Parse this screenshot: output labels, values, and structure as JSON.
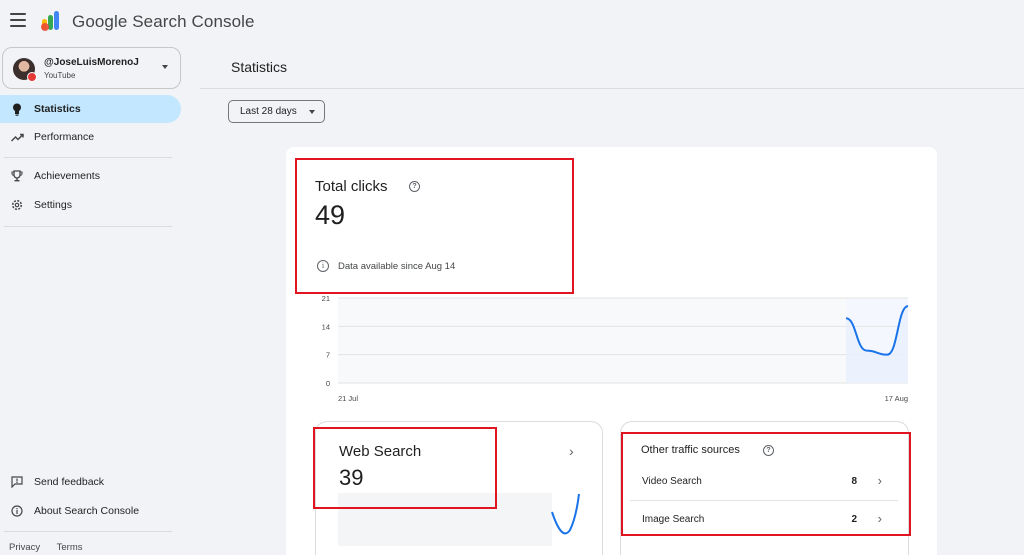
{
  "app": {
    "title": "Google Search Console"
  },
  "account": {
    "name": "@JoseLuisMorenoJ",
    "subtitle": "YouTube"
  },
  "sidebar": {
    "items": [
      {
        "label": "Statistics",
        "icon": "lightbulb-icon",
        "active": true
      },
      {
        "label": "Performance",
        "icon": "trending-up-icon"
      },
      {
        "label": "Achievements",
        "icon": "trophy-icon"
      },
      {
        "label": "Settings",
        "icon": "gear-icon"
      }
    ],
    "bottom": [
      {
        "label": "Send feedback",
        "icon": "feedback-icon"
      },
      {
        "label": "About Search Console",
        "icon": "info-icon"
      }
    ],
    "footer": {
      "privacy": "Privacy",
      "terms": "Terms"
    }
  },
  "main": {
    "title": "Statistics",
    "range": "Last 28 days",
    "total": {
      "label": "Total clicks",
      "value": "49",
      "info": "Data available since Aug 14"
    },
    "web_search": {
      "label": "Web Search",
      "value": "39"
    },
    "other": {
      "label": "Other traffic sources",
      "rows": [
        {
          "name": "Video Search",
          "value": "8"
        },
        {
          "name": "Image Search",
          "value": "2"
        }
      ]
    }
  },
  "colors": {
    "accent": "#1a73e8",
    "highlight": "#e0151f",
    "active_nav": "#c2e7ff"
  },
  "chart_data": {
    "type": "line",
    "yticks": [
      "21",
      "14",
      "7",
      "0"
    ],
    "ylim": [
      0,
      21
    ],
    "xlabels": [
      "21 Jul",
      "17 Aug"
    ],
    "series": [
      {
        "x": [
          "Aug 14",
          "Aug 15",
          "Aug 16",
          "Aug 17"
        ],
        "values": [
          16,
          8,
          7,
          19
        ]
      }
    ]
  }
}
